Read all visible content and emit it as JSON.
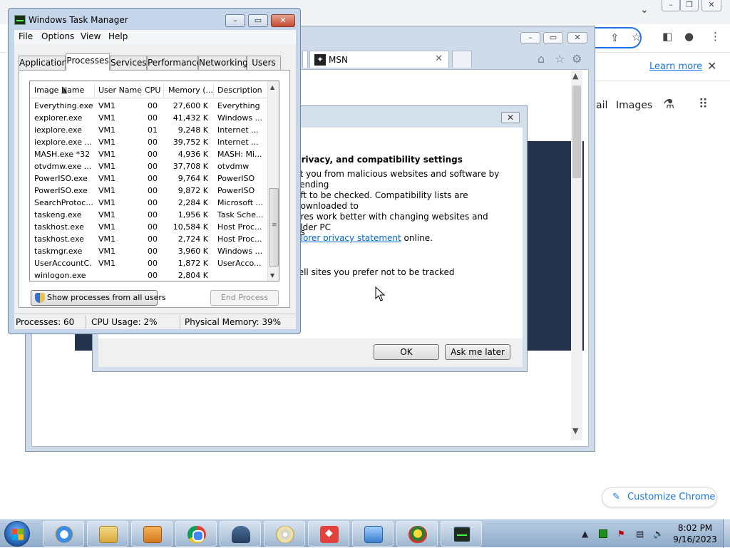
{
  "chrome": {
    "learn_more": "Learn more",
    "menu_mail": "ail",
    "menu_images": "Images",
    "customize_label": "Customize Chrome",
    "icons": [
      "share-icon",
      "star-icon",
      "sidebar-icon",
      "profile-icon",
      "menu-dots-icon",
      "labs-flask-icon",
      "apps-grid-icon",
      "pencil-icon"
    ]
  },
  "ie": {
    "tab_label": "MSN",
    "dialog": {
      "title": "privacy, and compatibility settings",
      "para_l1": "ct you from malicious websites and software by sending",
      "para_l2": "oft to be checked. Compatibility lists are downloaded to",
      "para_l3": "ures work better with changing websites and older PC",
      "link": "plorer privacy statement",
      "para_tail": " online.",
      "line2": "gs",
      "line3": "tell sites you prefer not to be tracked",
      "ok": "OK",
      "later": "Ask me later"
    }
  },
  "taskmgr": {
    "title": "Windows Task Manager",
    "menu": [
      "File",
      "Options",
      "View",
      "Help"
    ],
    "tabs": [
      "Applications",
      "Processes",
      "Services",
      "Performance",
      "Networking",
      "Users"
    ],
    "active_tab": "Processes",
    "columns": [
      "Image Name",
      "User Name",
      "CPU",
      "Memory (...",
      "Description"
    ],
    "rows": [
      [
        "Everything.exe",
        "VM1",
        "00",
        "27,600 K",
        "Everything"
      ],
      [
        "explorer.exe",
        "VM1",
        "00",
        "41,432 K",
        "Windows ..."
      ],
      [
        "iexplore.exe",
        "VM1",
        "01",
        "9,248 K",
        "Internet ..."
      ],
      [
        "iexplore.exe ...",
        "VM1",
        "00",
        "39,752 K",
        "Internet ..."
      ],
      [
        "MASH.exe *32",
        "VM1",
        "00",
        "4,936 K",
        "MASH: Mi..."
      ],
      [
        "otvdmw.exe ...",
        "VM1",
        "00",
        "37,708 K",
        "otvdmw"
      ],
      [
        "PowerISO.exe",
        "VM1",
        "00",
        "9,764 K",
        "PowerISO"
      ],
      [
        "PowerISO.exe",
        "VM1",
        "00",
        "9,872 K",
        "PowerISO"
      ],
      [
        "SearchProtoc...",
        "VM1",
        "00",
        "2,284 K",
        "Microsoft ..."
      ],
      [
        "taskeng.exe",
        "VM1",
        "00",
        "1,956 K",
        "Task Sche..."
      ],
      [
        "taskhost.exe",
        "VM1",
        "00",
        "10,584 K",
        "Host Proc..."
      ],
      [
        "taskhost.exe",
        "VM1",
        "00",
        "2,724 K",
        "Host Proc..."
      ],
      [
        "taskmgr.exe",
        "VM1",
        "00",
        "3,960 K",
        "Windows ..."
      ],
      [
        "UserAccountC...",
        "VM1",
        "00",
        "1,872 K",
        "UserAcco..."
      ],
      [
        "winlogon.exe",
        "",
        "00",
        "2,804 K",
        ""
      ]
    ],
    "show_all": "Show processes from all users",
    "end_process": "End Process",
    "status": {
      "processes": "Processes: 60",
      "cpu": "CPU Usage: 2%",
      "memory": "Physical Memory: 39%"
    }
  },
  "taskbar": {
    "time": "8:02 PM",
    "date": "9/16/2023",
    "apps": [
      "internet-explorer",
      "file-explorer",
      "media-player",
      "chrome",
      "car-app",
      "disc-app",
      "anydesk",
      "control-panel",
      "bug-app",
      "task-manager"
    ]
  }
}
